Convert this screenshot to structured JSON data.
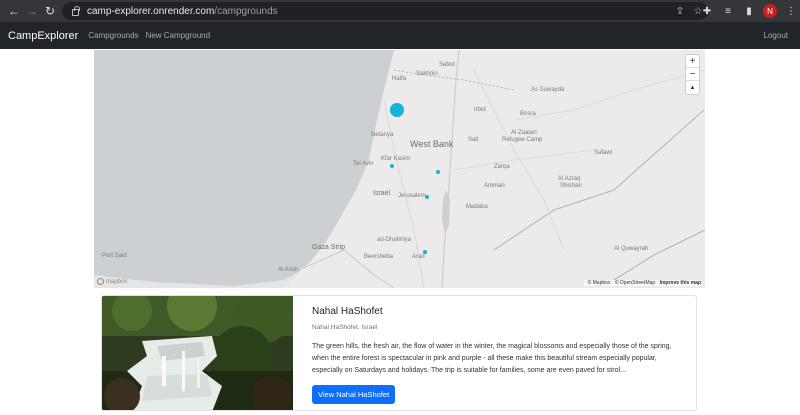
{
  "browser": {
    "url_host": "camp-explorer.onrender.com",
    "url_path": "/campgrounds",
    "profile_initial": "N",
    "icons": [
      "back-arrow-icon",
      "forward-arrow-icon",
      "reload-icon",
      "lock-icon",
      "share-icon",
      "bookmark-star-icon",
      "extensions-puzzle-icon",
      "reading-list-icon",
      "side-panel-icon",
      "kebab-menu-icon"
    ]
  },
  "navbar": {
    "brand": "CampExplorer",
    "links": [
      "Campgrounds",
      "New Campground"
    ],
    "logout": "Logout"
  },
  "map": {
    "labels": {
      "haifa": "Haifa",
      "sakhnin": "Sakhnin",
      "safed": "Safed",
      "as_suwayda": "As Suwayda",
      "irbid": "Irbid",
      "bosra": "Bosra",
      "netanya": "Netanya",
      "west_bank": "West Bank",
      "salt": "Salt",
      "zaatari": "Al Zaatari",
      "refugee": "Refugee Camp",
      "tel_aviv": "Tel Aviv",
      "kfar_kasim": "Kfar Kasim",
      "zarqa": "Zarqa",
      "safawi": "Safawi",
      "al_azraq": "Al Azraq",
      "shishan": "Shishan",
      "israel": "Israel",
      "jerusalem": "Jerusalem",
      "amman": "Amman",
      "madaba": "Madaba",
      "gaza_strip": "Gaza Strip",
      "ad_dhahiriya": "ad-Dhahiriya",
      "al_quwayrah": "Al Quwayrah",
      "port_said": "Port Said",
      "beersheba": "Beersheba",
      "arad": "Arad",
      "al_arish": "Al Arish"
    },
    "zoom_in": "+",
    "zoom_out": "−",
    "compass": "▲",
    "logo_text": "mapbox",
    "attribution": [
      "© Mapbox",
      "© OpenStreetMap",
      "Improve this map"
    ],
    "marker_color": "#11b4da"
  },
  "card": {
    "title": "Nahal HaShofet",
    "location": "Nahal HaShofet, Israel",
    "description": "The green hills, the fresh air, the flow of water in the winter, the magical blossoms and especially those of the spring, when the entire forest is spectacular in pink and purple - all these make this beautiful stream especially popular, especially on Saturdays and holidays. The trip is suitable for families, some are even paved for strol...",
    "button": "View Nahal HaShofet"
  }
}
